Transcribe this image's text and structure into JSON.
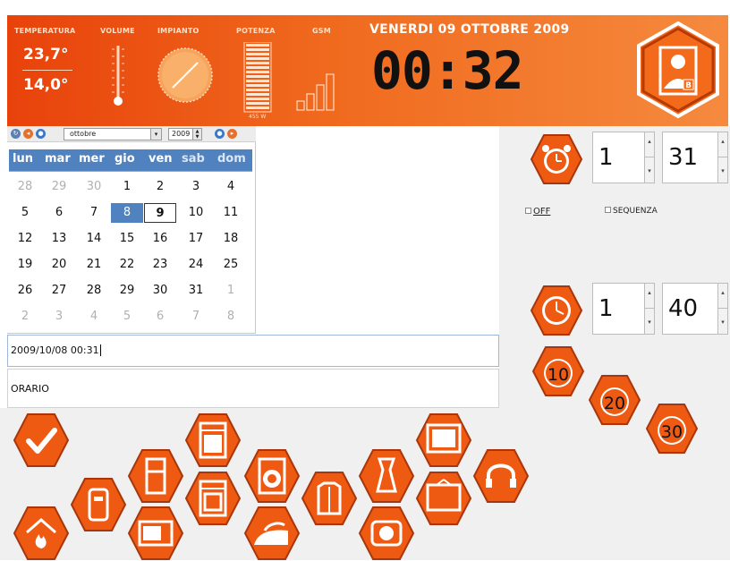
{
  "header": {
    "labels": {
      "temperatura": "TEMPERATURA",
      "volume": "VOLUME",
      "impianto": "IMPIANTO",
      "potenza": "POTENZA",
      "gsm": "GSM"
    },
    "temperature_main": "23,7°",
    "temperature_set": "14,0°",
    "power_value": "455 W",
    "date": "VENERDI 09 OTTOBRE 2009",
    "time": "00:32",
    "user_badge": "B",
    "volume_level": 0.2,
    "power_level": 1.0,
    "gsm_bars": 4
  },
  "calendar": {
    "month": "ottobre",
    "year": "2009",
    "weekdays": [
      "lun",
      "mar",
      "mer",
      "gio",
      "ven",
      "sab",
      "dom"
    ],
    "weeks": [
      [
        "28",
        "29",
        "30",
        "1",
        "2",
        "3",
        "4"
      ],
      [
        "5",
        "6",
        "7",
        "8",
        "9",
        "10",
        "11"
      ],
      [
        "12",
        "13",
        "14",
        "15",
        "16",
        "17",
        "18"
      ],
      [
        "19",
        "20",
        "21",
        "22",
        "23",
        "24",
        "25"
      ],
      [
        "26",
        "27",
        "28",
        "29",
        "30",
        "31",
        "1"
      ],
      [
        "2",
        "3",
        "4",
        "5",
        "6",
        "7",
        "8"
      ]
    ],
    "selected_day": "8",
    "today": "9"
  },
  "fields": {
    "datetime": "2009/10/08 00:31",
    "orario": "ORARIO"
  },
  "alarm": {
    "spin1": "1",
    "spin2": "31",
    "off_label": "OFF",
    "sequenza_label": "SEQUENZA"
  },
  "timer": {
    "spin1": "1",
    "spin2": "40",
    "quick": [
      "10",
      "20",
      "30"
    ]
  },
  "colors": {
    "orange": "#ef5a12",
    "orange_dark": "#c23e06",
    "calendar_blue": "#5082c0"
  },
  "devices": [
    "confirm-check-icon",
    "heating-flame-icon",
    "water-heater-icon",
    "refrigerator-icon",
    "microwave-icon",
    "dishwasher-icon",
    "oven-icon",
    "washing-machine-icon",
    "iron-icon",
    "shirts-icon",
    "coffee-maker-icon",
    "toaster-icon",
    "tv-icon",
    "tv-small-icon",
    "headphones-icon"
  ]
}
